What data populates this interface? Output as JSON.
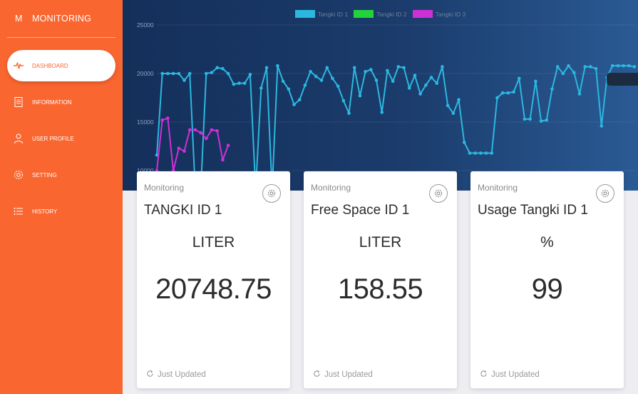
{
  "sidebar": {
    "brand_mini": "M",
    "brand_name": "MONITORING",
    "items": [
      {
        "label": "DASHBOARD",
        "icon": "pulse-icon",
        "active": true
      },
      {
        "label": "INFORMATION",
        "icon": "document-icon",
        "active": false
      },
      {
        "label": "USER PROFILE",
        "icon": "user-icon",
        "active": false
      },
      {
        "label": "SETTING",
        "icon": "gear-icon",
        "active": false
      },
      {
        "label": "HISTORY",
        "icon": "list-icon",
        "active": false
      }
    ]
  },
  "colors": {
    "sidebar": "#fa6630",
    "header_dark": "#142f5a",
    "header_light": "#2a5a94",
    "series1": "#2bb8e0",
    "series2": "#22d33a",
    "series3": "#cf30d6"
  },
  "chart_data": {
    "type": "line",
    "yticks": [
      "25000",
      "20000",
      "15000",
      "10000"
    ],
    "ylim": [
      9600,
      25000
    ],
    "grid": true,
    "legend_position": "top-center",
    "series": [
      {
        "name": "Tangki ID 1",
        "color": "#2bb8e0",
        "values": [
          11600,
          20000,
          20000,
          20000,
          20000,
          19300,
          20000,
          8000,
          8000,
          20000,
          20100,
          20600,
          20500,
          20000,
          18900,
          19000,
          19000,
          19900,
          8000,
          18500,
          20600,
          8000,
          20800,
          19200,
          18400,
          16800,
          17300,
          18800,
          20200,
          19700,
          19300,
          20600,
          19500,
          18700,
          17200,
          15900,
          20600,
          17700,
          20200,
          20400,
          19300,
          16000,
          20300,
          19200,
          20700,
          20600,
          18500,
          19800,
          17900,
          18800,
          19600,
          19000,
          20700,
          16700,
          15900,
          17300,
          12900,
          11800,
          11800,
          11800,
          11800,
          11800,
          17500,
          18000,
          18000,
          18100,
          19500,
          15300,
          15300,
          19200,
          15100,
          15200,
          18400,
          20700,
          20000,
          20800,
          20100,
          17900,
          20700,
          20700,
          20500,
          14600,
          19600,
          20800,
          20800,
          20800,
          20800,
          20700
        ]
      },
      {
        "name": "Tangki ID 2",
        "color": "#22d33a",
        "values": []
      },
      {
        "name": "Tangki ID 3",
        "color": "#cf30d6",
        "values": [
          10000,
          15200,
          15400,
          10000,
          12300,
          12000,
          14200,
          14200,
          13900,
          13300,
          14200,
          14100,
          11100,
          12600
        ]
      }
    ]
  },
  "cards": [
    {
      "category": "Monitoring",
      "title": "TANGKI ID 1",
      "unit": "LITER",
      "value": "20748.75",
      "footer": "Just Updated"
    },
    {
      "category": "Monitoring",
      "title": "Free Space ID 1",
      "unit": "LITER",
      "value": "158.55",
      "footer": "Just Updated"
    },
    {
      "category": "Monitoring",
      "title": "Usage Tangki ID 1",
      "unit": "%",
      "value": "99",
      "footer": "Just Updated"
    }
  ]
}
